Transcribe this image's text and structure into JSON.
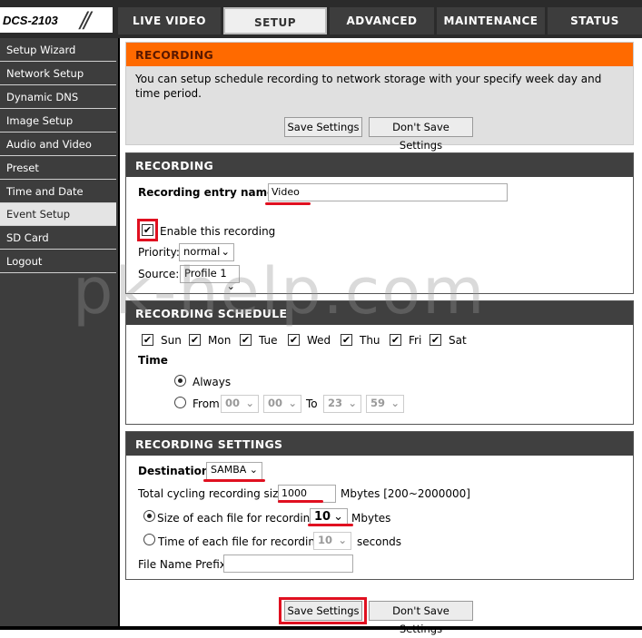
{
  "header": {
    "model": "DCS-2103",
    "tabs": [
      "LIVE VIDEO",
      "SETUP",
      "ADVANCED",
      "MAINTENANCE",
      "STATUS"
    ],
    "active_tab": "SETUP"
  },
  "sidebar": {
    "items": [
      "Setup Wizard",
      "Network Setup",
      "Dynamic DNS",
      "Image Setup",
      "Audio and Video",
      "Preset",
      "Time and Date",
      "Event Setup",
      "SD Card",
      "Logout"
    ],
    "active": "Event Setup"
  },
  "intro": {
    "title": "RECORDING",
    "text": "You can setup schedule recording to network storage with your specify week day and time period.",
    "save": "Save Settings",
    "dont_save": "Don't Save Settings"
  },
  "recording": {
    "title": "RECORDING",
    "entry_label": "Recording entry name:",
    "entry_value": "Video",
    "enable_label": "Enable this recording",
    "enable_checked": true,
    "priority_label": "Priority:",
    "priority_value": "normal",
    "source_label": "Source:",
    "source_value": "Profile 1"
  },
  "schedule": {
    "title": "RECORDING SCHEDULE",
    "days": [
      "Sun",
      "Mon",
      "Tue",
      "Wed",
      "Thu",
      "Fri",
      "Sat"
    ],
    "time_label": "Time",
    "always_label": "Always",
    "from_label": "From",
    "to_label": "To",
    "from_h": "00",
    "from_m": "00",
    "to_h": "23",
    "to_m": "59",
    "mode": "Always"
  },
  "settings": {
    "title": "RECORDING SETTINGS",
    "dest_label": "Destination",
    "dest_value": "SAMBA",
    "total_label": "Total cycling recording size:",
    "total_value": "1000",
    "total_unit": "Mbytes [200~2000000]",
    "size_label": "Size of each file for recording:",
    "size_value": "10",
    "size_unit": "Mbytes",
    "time_label": "Time of each file for recording:",
    "time_value": "10",
    "time_unit": "seconds",
    "prefix_label": "File Name Prefix:",
    "prefix_value": "",
    "mode": "size"
  },
  "footer": {
    "save": "Save Settings",
    "dont_save": "Don't Save Settings"
  },
  "watermark": "pk-help.com",
  "colors": {
    "accent": "#ff6a00",
    "header": "#404040",
    "highlight": "#e01020"
  }
}
